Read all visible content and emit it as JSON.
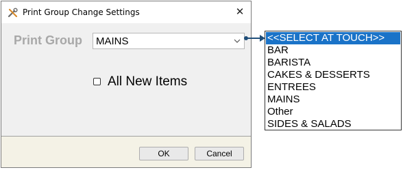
{
  "window": {
    "title": "Print Group Change Settings",
    "close_glyph": "✕"
  },
  "form": {
    "print_group_label": "Print Group",
    "print_group_value": "MAINS",
    "all_new_items_label": "All New Items",
    "all_new_items_checked": false
  },
  "buttons": {
    "ok": "OK",
    "cancel": "Cancel"
  },
  "dropdown": {
    "items": [
      "<<SELECT AT TOUCH>>",
      "BAR",
      "BARISTA",
      "CAKES & DESSERTS",
      "ENTREES",
      "MAINS",
      "Other",
      "SIDES & SALADS"
    ],
    "highlighted_index": 0
  },
  "colors": {
    "highlight": "#1a73c8",
    "label_gray": "#a8a8a8",
    "footer_bg": "#f4f2e6",
    "connector": "#1f4e79"
  },
  "icons": {
    "app": "settings-tools-icon",
    "dropdown": "chevron-down-icon"
  }
}
